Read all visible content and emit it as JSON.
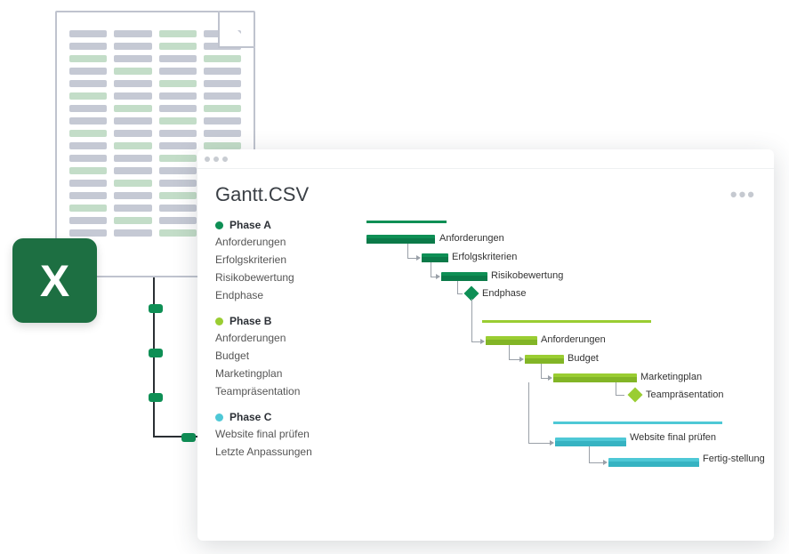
{
  "window": {
    "title": "Gantt.CSV"
  },
  "colors": {
    "phaseA": "#0e8f55",
    "phaseA_dark": "#0b7a49",
    "phaseB": "#9acd32",
    "phaseB_dark": "#82b526",
    "phaseC": "#4ec8d6",
    "phaseC_dark": "#36b3c2"
  },
  "phases": [
    {
      "id": "A",
      "name": "Phase A",
      "color": "#0e8f55",
      "summary": {
        "start": 0,
        "end": 90
      },
      "tasks": [
        {
          "label": "Anforderungen",
          "barLabel": "Anforderungen",
          "start": 0,
          "end": 70
        },
        {
          "label": "Erfolgskriterien",
          "barLabel": "Erfolgskriterien",
          "start": 58,
          "end": 88
        },
        {
          "label": "Risikobewertung",
          "barLabel": "Risikobewertung",
          "start": 70,
          "end": 128
        },
        {
          "label": "Endphase",
          "barLabel": "Endphase",
          "milestone": true,
          "at": 112
        }
      ]
    },
    {
      "id": "B",
      "name": "Phase B",
      "color": "#9acd32",
      "summary": {
        "start": 130,
        "end": 320
      },
      "tasks": [
        {
          "label": "Anforderungen",
          "barLabel": "Anforderungen",
          "start": 130,
          "end": 190
        },
        {
          "label": "Budget",
          "barLabel": "Budget",
          "start": 174,
          "end": 218
        },
        {
          "label": "Marketingplan",
          "barLabel": "Marketingplan",
          "start": 202,
          "end": 300
        },
        {
          "label": "Teampräsentation",
          "barLabel": "Teampräsentation",
          "milestone": true,
          "at": 298
        }
      ]
    },
    {
      "id": "C",
      "name": "Phase C",
      "color": "#4ec8d6",
      "summary": {
        "start": 210,
        "end": 400
      },
      "tasks": [
        {
          "label": "Website final prüfen",
          "barLabel": "Website final prüfen",
          "start": 210,
          "end": 290
        },
        {
          "label": "Letzte Anpassungen",
          "barLabel": "Fertig-stellung",
          "start": 268,
          "end": 372
        }
      ]
    }
  ]
}
